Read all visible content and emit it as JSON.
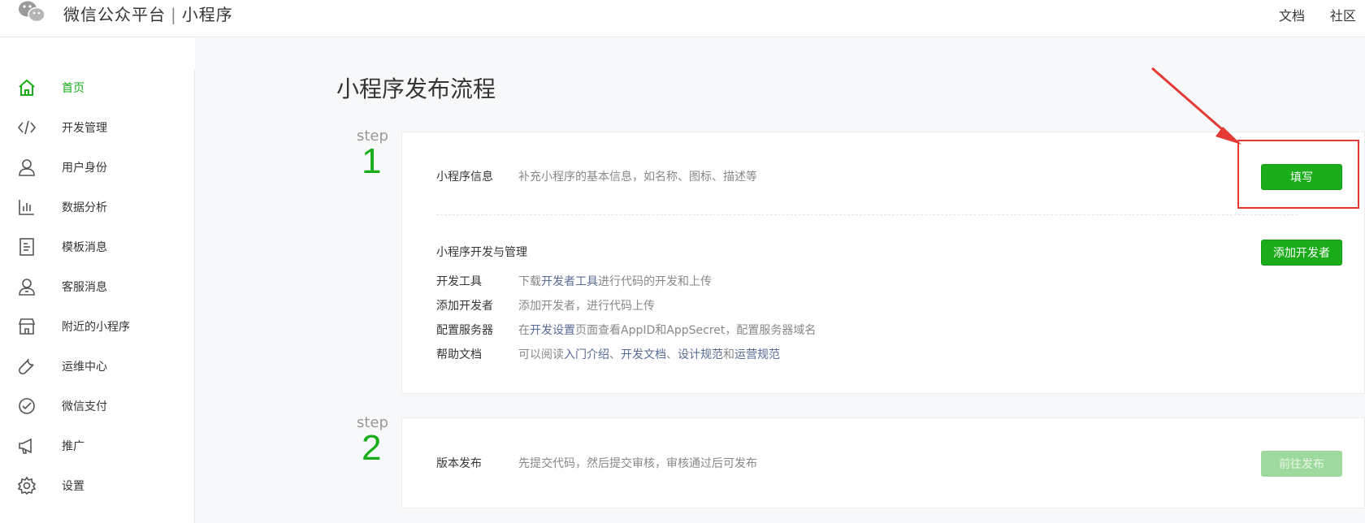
{
  "header": {
    "brand_name": "微信公众平台",
    "separator": "|",
    "product_name": "小程序",
    "links": [
      "文档",
      "社区"
    ]
  },
  "sidebar": {
    "items": [
      {
        "label": "首页",
        "icon": "home-icon",
        "active": true
      },
      {
        "label": "开发管理",
        "icon": "code-icon"
      },
      {
        "label": "用户身份",
        "icon": "user-icon"
      },
      {
        "label": "数据分析",
        "icon": "chart-icon"
      },
      {
        "label": "模板消息",
        "icon": "document-icon"
      },
      {
        "label": "客服消息",
        "icon": "headset-user-icon"
      },
      {
        "label": "附近的小程序",
        "icon": "store-icon"
      },
      {
        "label": "运维中心",
        "icon": "wrench-icon"
      },
      {
        "label": "微信支付",
        "icon": "pay-icon"
      },
      {
        "label": "推广",
        "icon": "megaphone-icon"
      },
      {
        "label": "设置",
        "icon": "gear-icon"
      }
    ]
  },
  "main": {
    "title": "小程序发布流程",
    "steps": [
      {
        "word": "step",
        "number": "1",
        "info": {
          "label": "小程序信息",
          "desc": "补充小程序的基本信息，如名称、图标、描述等",
          "button": "填写"
        },
        "dev": {
          "heading": "小程序开发与管理",
          "button": "添加开发者",
          "rows": [
            {
              "label": "开发工具",
              "parts": [
                {
                  "t": "下载"
                },
                {
                  "t": "开发者工具",
                  "link": true
                },
                {
                  "t": "进行代码的开发和上传"
                }
              ]
            },
            {
              "label": "添加开发者",
              "parts": [
                {
                  "t": "添加开发者，进行代码上传"
                }
              ]
            },
            {
              "label": "配置服务器",
              "parts": [
                {
                  "t": "在"
                },
                {
                  "t": "开发设置",
                  "link": true
                },
                {
                  "t": "页面查看AppID和AppSecret，配置服务器域名"
                }
              ]
            },
            {
              "label": "帮助文档",
              "parts": [
                {
                  "t": "可以阅读"
                },
                {
                  "t": "入门介绍",
                  "link": true
                },
                {
                  "t": "、"
                },
                {
                  "t": "开发文档",
                  "link": true
                },
                {
                  "t": "、"
                },
                {
                  "t": "设计规范",
                  "link": true
                },
                {
                  "t": "和"
                },
                {
                  "t": "运营规范",
                  "link": true
                }
              ]
            }
          ]
        }
      },
      {
        "word": "step",
        "number": "2",
        "release": {
          "label": "版本发布",
          "desc": "先提交代码，然后提交审核，审核通过后可发布",
          "button": "前往发布",
          "button_disabled": true
        }
      }
    ]
  },
  "colors": {
    "accent": "#1aad19",
    "link": "#576b95",
    "annotation": "#e53935"
  }
}
